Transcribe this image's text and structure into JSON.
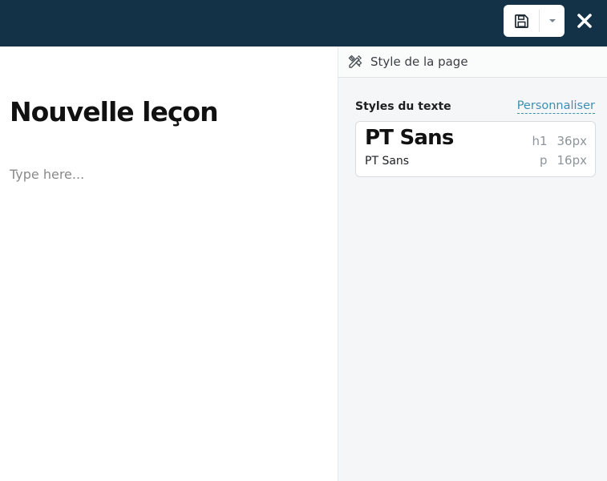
{
  "editor": {
    "title": "Nouvelle leçon",
    "body_placeholder": "Type here..."
  },
  "toolbar": {
    "save_icon": "floppy-disk-icon",
    "caret_icon": "caret-down-icon",
    "close_icon": "close-icon"
  },
  "panel": {
    "header_icon": "pencil-ruler-icon",
    "header_title": "Style de la page",
    "section_title": "Styles du texte",
    "customize_link": "Personnaliser",
    "card": {
      "heading_font": "PT Sans",
      "heading_tag": "h1",
      "heading_size": "36px",
      "paragraph_font": "PT Sans",
      "paragraph_tag": "p",
      "paragraph_size": "16px"
    }
  },
  "colors": {
    "topbar": "#133247",
    "link": "#3d8fb1",
    "panel_bg": "#f5f6f7"
  }
}
